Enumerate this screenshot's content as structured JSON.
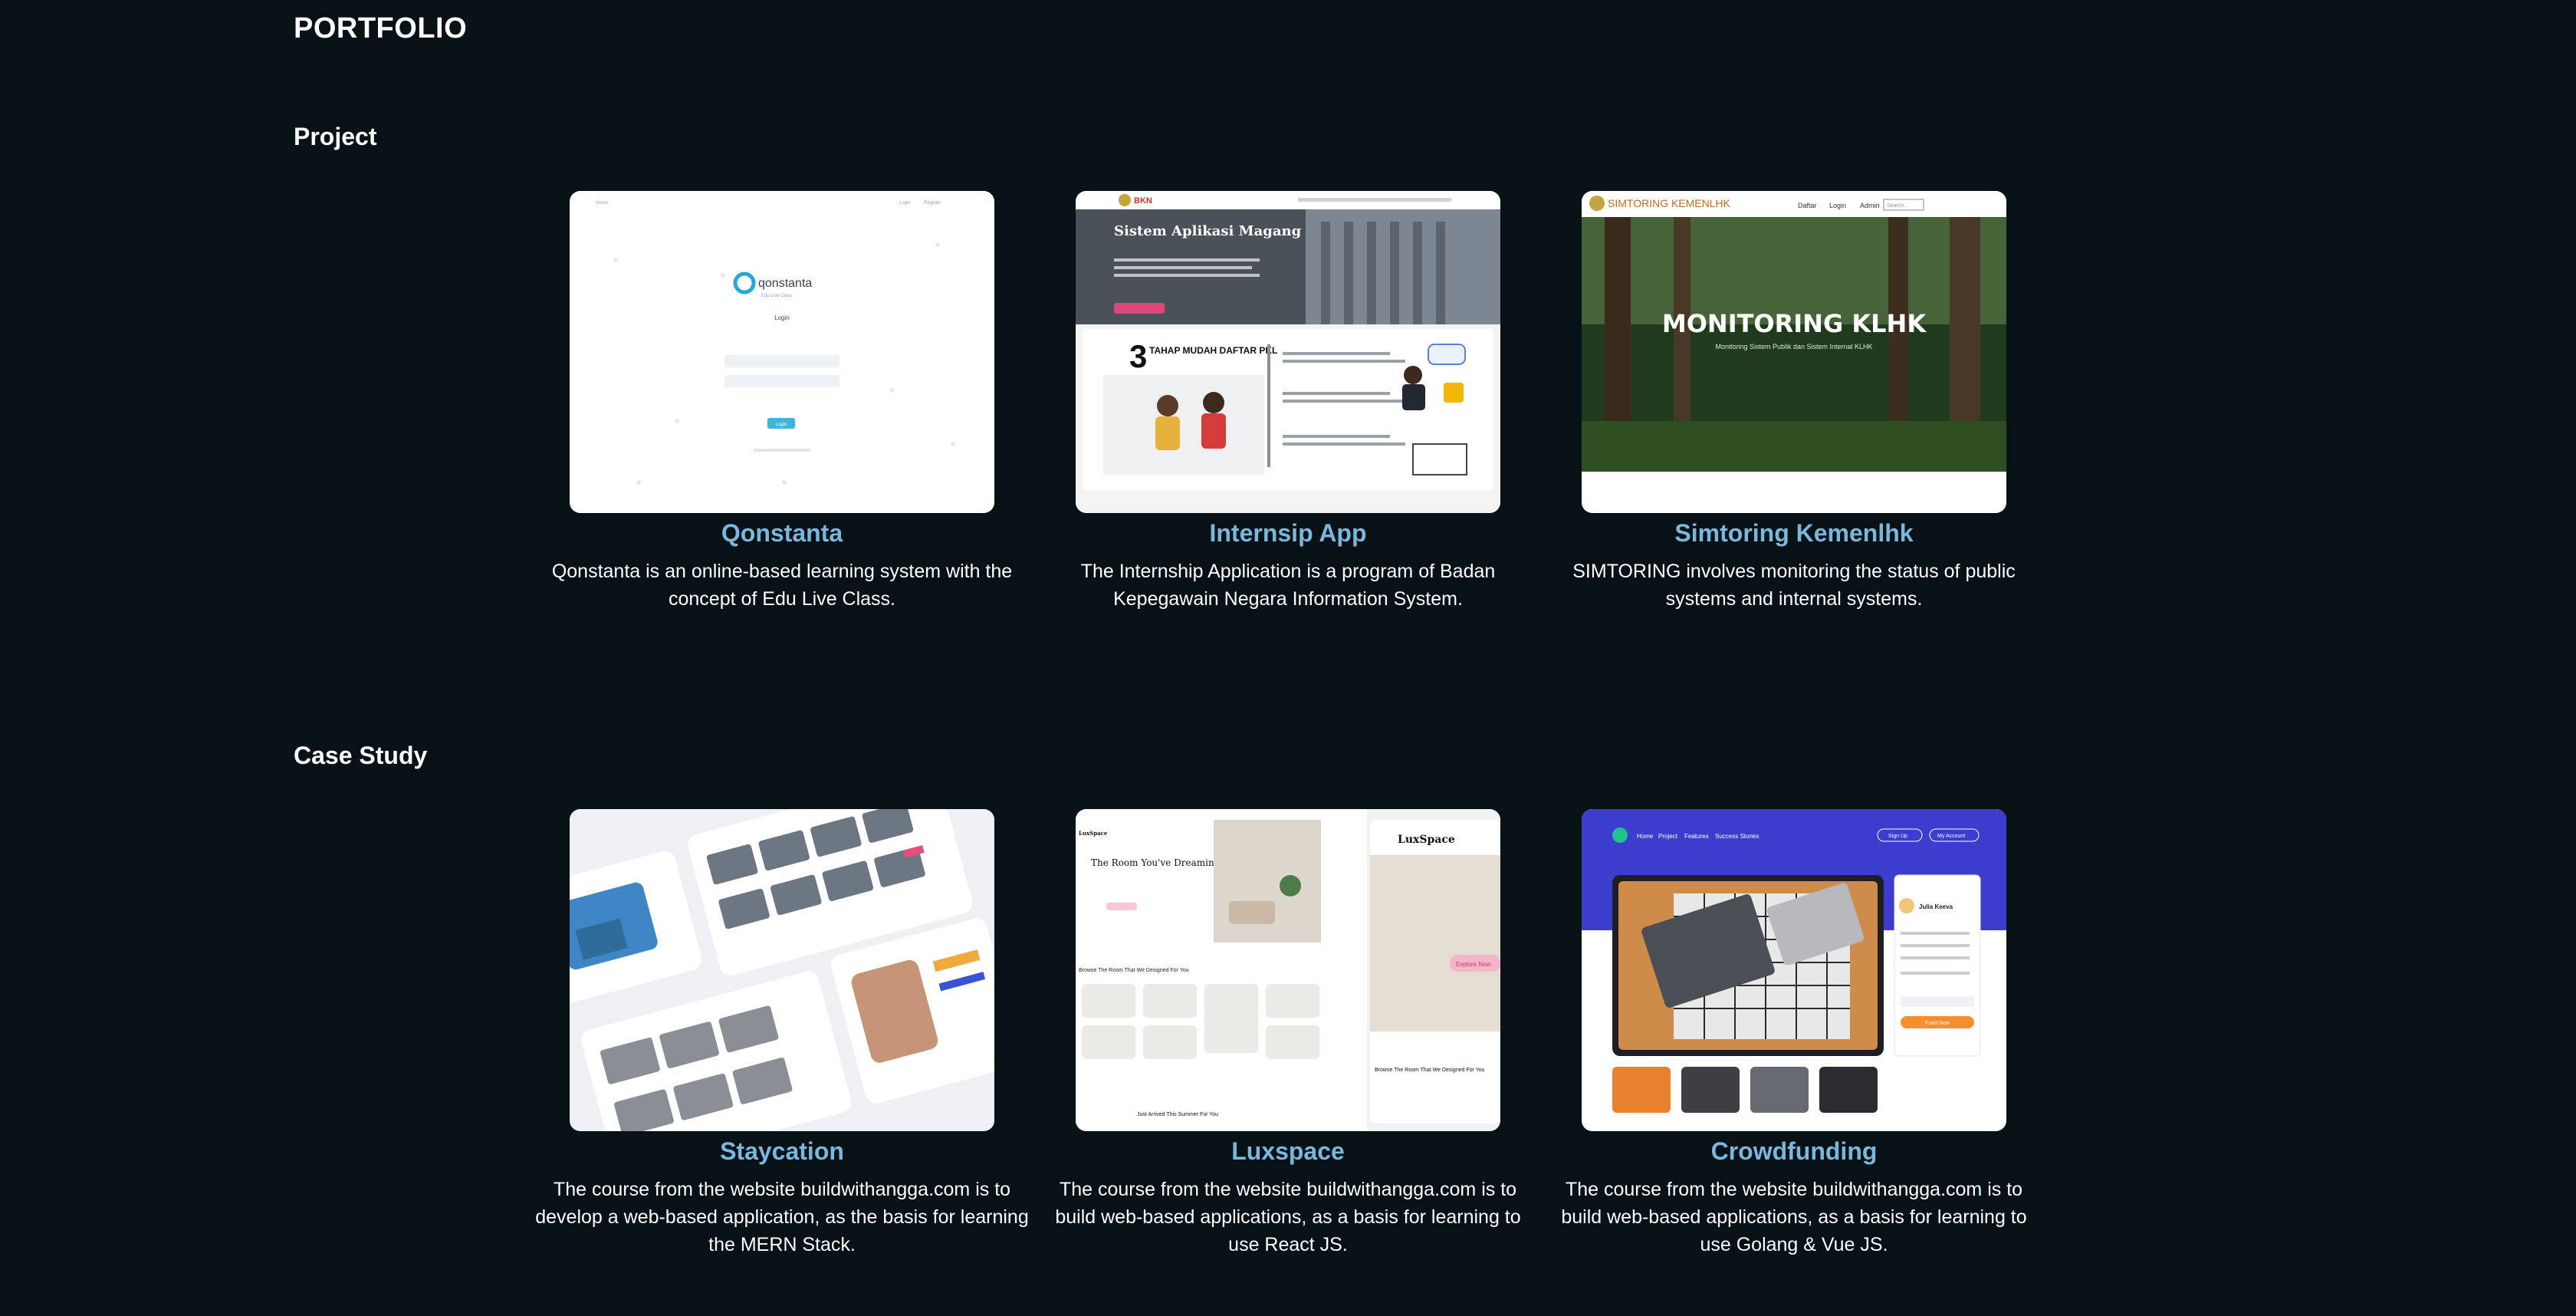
{
  "page": {
    "title": "PORTFOLIO"
  },
  "sections": {
    "project": {
      "title": "Project",
      "cards": [
        {
          "title": "Qonstanta",
          "description": "Qonstanta is an online-based learning system with the concept of Edu Live Class.",
          "image": {
            "logo": "qonstanta",
            "tagline": "Edu Live Class",
            "heading": "Login",
            "button": "Login"
          }
        },
        {
          "title": "Internsip App",
          "description": "The Internship Application is a program of Badan Kepegawain Negara Information System.",
          "image": {
            "brand": "BKN",
            "heading": "Sistem Aplikasi Magang",
            "banner_number": "3",
            "banner_text": "TAHAP MUDAH DAFTAR PKL"
          }
        },
        {
          "title": "Simtoring Kemenlhk",
          "description": "SIMTORING involves monitoring the status of public systems and internal systems.",
          "image": {
            "brand": "SIMTORING KEMENLHK",
            "nav": [
              "Daftar",
              "Login",
              "Admin"
            ],
            "search": "Search...",
            "heading": "MONITORING KLHK",
            "subheading": "Monitoring Sistem Publik dan Sistem Internal KLHK"
          }
        }
      ]
    },
    "case_study": {
      "title": "Case Study",
      "cards": [
        {
          "title": "Staycation",
          "description": "The course from the website buildwithangga.com is to develop a web-based application, as the basis for learning the MERN Stack.",
          "image": {
            "theme": "property listing mockups"
          }
        },
        {
          "title": "Luxspace",
          "description": "The course from the website buildwithangga.com is to build web-based applications, as a basis for learning to use React JS.",
          "image": {
            "brand": "LuxSpace",
            "heading": "The Room You've Dreaming",
            "section": "Browse The Room That We Designed For You",
            "cta": "Explore Now",
            "footer": "Just Arrived This Summer For You"
          }
        },
        {
          "title": "Crowdfunding",
          "description": "The course from the website buildwithangga.com is to build web-based applications, as a basis for learning to use Golang & Vue JS.",
          "image": {
            "nav": [
              "Home",
              "Project",
              "Features",
              "Success Stories"
            ],
            "signup": "Sign Up",
            "account": "My Account",
            "person": "Julia Keeva",
            "button": "Fund Now"
          }
        }
      ]
    }
  },
  "colors": {
    "background": "#081115",
    "accent": "#79b7dc",
    "text": "#ffffff"
  }
}
